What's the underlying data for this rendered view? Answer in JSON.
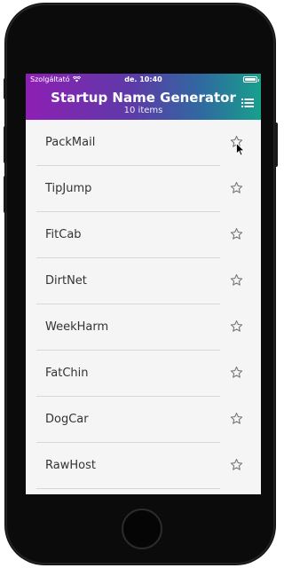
{
  "status_bar": {
    "carrier": "Szolgáltató",
    "time": "de. 10:40"
  },
  "app_bar": {
    "title": "Startup Name Generator",
    "subtitle": "10 items",
    "list_icon": "list-icon"
  },
  "items": [
    {
      "name": "PackMail",
      "icon": "star-outline-icon"
    },
    {
      "name": "TipJump",
      "icon": "star-outline-icon"
    },
    {
      "name": "FitCab",
      "icon": "star-outline-icon"
    },
    {
      "name": "DirtNet",
      "icon": "star-outline-icon"
    },
    {
      "name": "WeekHarm",
      "icon": "star-outline-icon"
    },
    {
      "name": "FatChin",
      "icon": "star-outline-icon"
    },
    {
      "name": "DogCar",
      "icon": "star-outline-icon"
    },
    {
      "name": "RawHost",
      "icon": "star-outline-icon"
    }
  ],
  "colors": {
    "gradient_start": "#8e1fb4",
    "gradient_end": "#18a08c",
    "list_background": "#f5f5f5",
    "divider": "#d8d8d8",
    "text": "#333333"
  }
}
